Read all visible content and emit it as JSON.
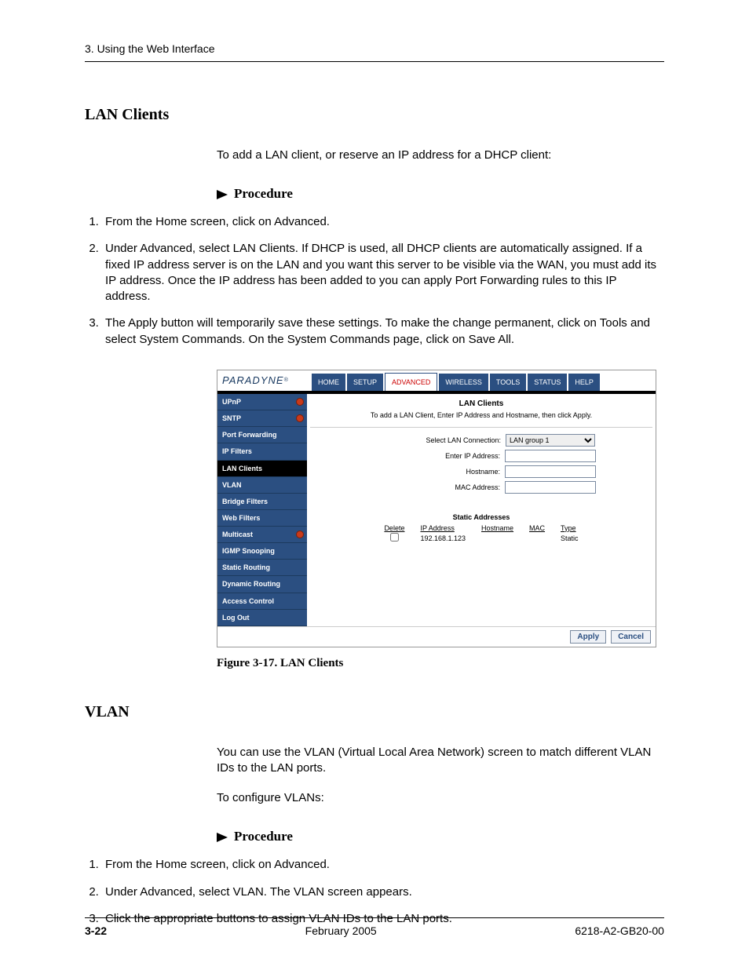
{
  "header": {
    "running": "3. Using the Web Interface"
  },
  "section1": {
    "title": "LAN Clients",
    "intro": "To add a LAN client, or reserve an IP address for a DHCP client:",
    "procedure_label": "Procedure",
    "steps": [
      "From the Home screen, click on Advanced.",
      "Under Advanced, select LAN Clients. If DHCP is used, all DHCP clients are automatically assigned. If a fixed IP address server is on the LAN and you want this server to be visible via the WAN, you must add its IP address. Once the IP address has been added to you can apply Port Forwarding rules to this IP address.",
      "The Apply button will temporarily save these settings. To make the change permanent, click on Tools and select System Commands. On the System Commands page, click on Save All."
    ],
    "caption": "Figure 3-17.   LAN Clients"
  },
  "ui": {
    "brand": "PARADYNE",
    "tabs": [
      "HOME",
      "SETUP",
      "ADVANCED",
      "WIRELESS",
      "TOOLS",
      "STATUS",
      "HELP"
    ],
    "active_tab_index": 2,
    "sidebar": [
      {
        "label": "UPnP",
        "dot": true,
        "active": false
      },
      {
        "label": "SNTP",
        "dot": true,
        "active": false
      },
      {
        "label": "Port Forwarding",
        "dot": false,
        "active": false
      },
      {
        "label": "IP Filters",
        "dot": false,
        "active": false
      },
      {
        "label": "LAN Clients",
        "dot": false,
        "active": true
      },
      {
        "label": "VLAN",
        "dot": false,
        "active": false
      },
      {
        "label": "Bridge Filters",
        "dot": false,
        "active": false
      },
      {
        "label": "Web Filters",
        "dot": false,
        "active": false
      },
      {
        "label": "Multicast",
        "dot": true,
        "active": false
      },
      {
        "label": "IGMP Snooping",
        "dot": false,
        "active": false
      },
      {
        "label": "Static Routing",
        "dot": false,
        "active": false
      },
      {
        "label": "Dynamic Routing",
        "dot": false,
        "active": false
      },
      {
        "label": "Access Control",
        "dot": false,
        "active": false
      },
      {
        "label": "Log Out",
        "dot": false,
        "active": false
      }
    ],
    "panel": {
      "title": "LAN Clients",
      "subtitle": "To add a LAN Client, Enter IP Address and Hostname, then click Apply.",
      "fields": {
        "conn_label": "Select LAN Connection:",
        "conn_value": "LAN group 1",
        "ip_label": "Enter IP Address:",
        "ip_value": "",
        "host_label": "Hostname:",
        "host_value": "",
        "mac_label": "MAC Address:",
        "mac_value": ""
      },
      "static_title": "Static Addresses",
      "static_headers": [
        "Delete",
        "IP Address",
        "Hostname",
        "MAC",
        "Type"
      ],
      "static_row": {
        "ip": "192.168.1.123",
        "hostname": "",
        "mac": "",
        "type": "Static"
      }
    },
    "actions": {
      "apply": "Apply",
      "cancel": "Cancel"
    }
  },
  "section2": {
    "title": "VLAN",
    "intro1": "You can use the VLAN (Virtual Local Area Network) screen to match different VLAN IDs to the LAN ports.",
    "intro2": "To configure VLANs:",
    "procedure_label": "Procedure",
    "steps": [
      "From the Home screen, click on Advanced.",
      "Under Advanced, select VLAN. The VLAN screen appears.",
      "Click the appropriate buttons to assign VLAN IDs to the LAN ports."
    ]
  },
  "footer": {
    "page": "3-22",
    "date": "February 2005",
    "doc": "6218-A2-GB20-00"
  }
}
